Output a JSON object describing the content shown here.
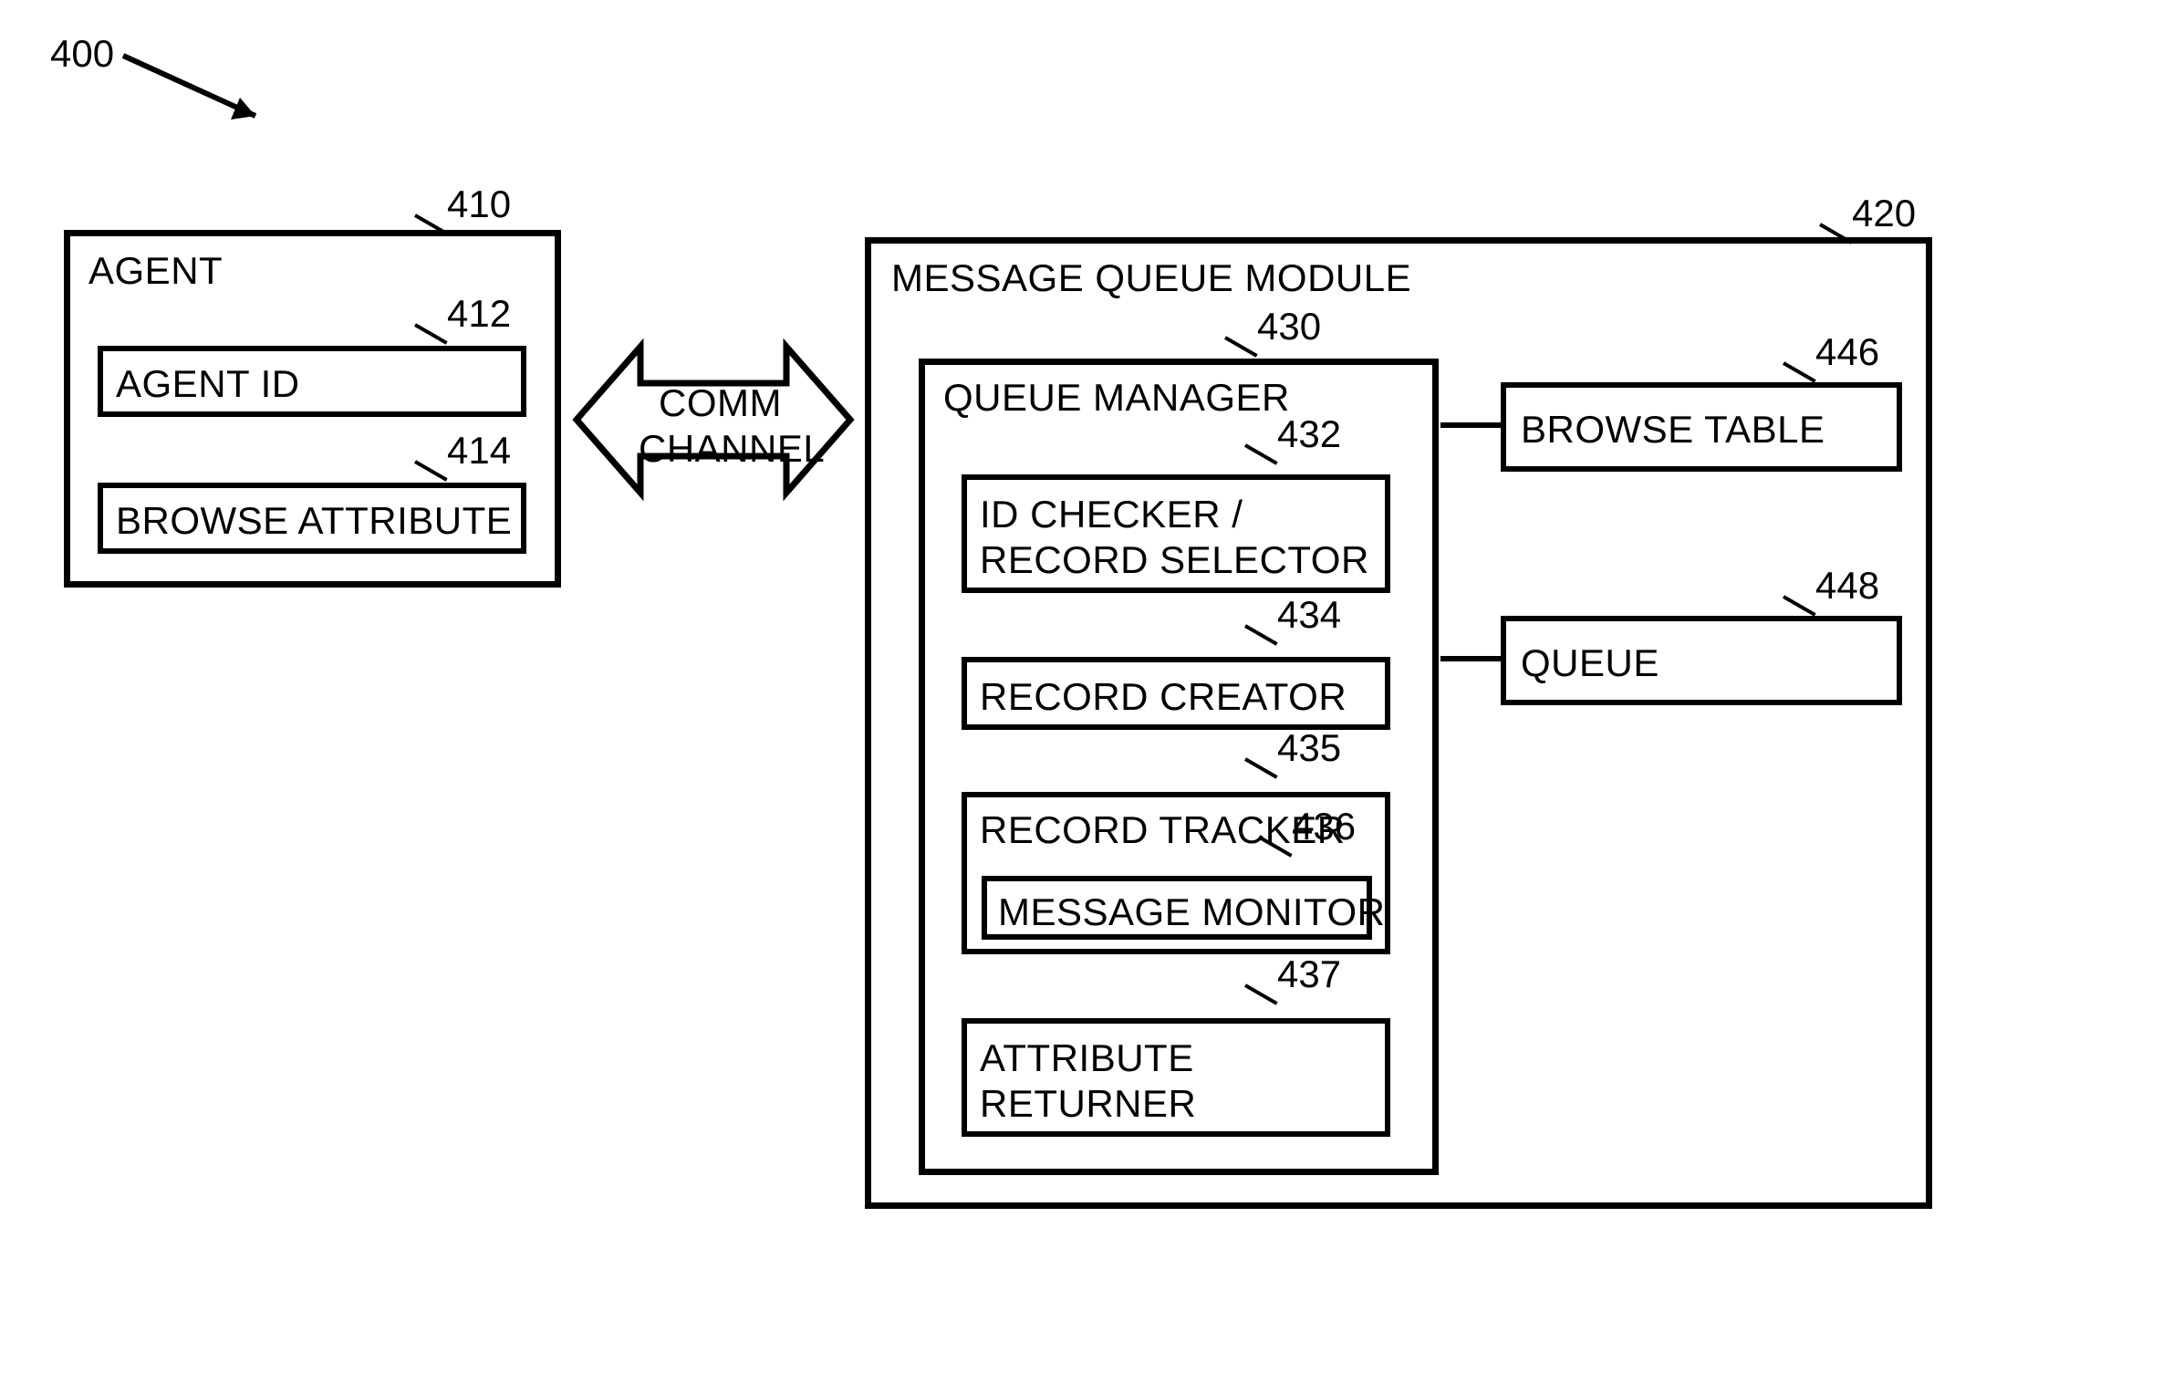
{
  "figure_ref": "400",
  "agent": {
    "ref": "410",
    "title": "AGENT",
    "agent_id": {
      "ref": "412",
      "label": "AGENT ID"
    },
    "browse_attribute": {
      "ref": "414",
      "label": "BROWSE ATTRIBUTE"
    }
  },
  "comm_channel": {
    "line1": "COMM",
    "line2": "CHANNEL"
  },
  "mq_module": {
    "ref": "420",
    "title": "MESSAGE QUEUE MODULE",
    "queue_manager": {
      "ref": "430",
      "title": "QUEUE MANAGER",
      "id_checker": {
        "ref": "432",
        "line1": "ID CHECKER /",
        "line2": "RECORD SELECTOR"
      },
      "record_creator": {
        "ref": "434",
        "label": "RECORD CREATOR"
      },
      "record_tracker": {
        "ref": "435",
        "label": "RECORD TRACKER",
        "message_monitor": {
          "ref": "436",
          "label": "MESSAGE MONITOR"
        }
      },
      "attribute_returner": {
        "ref": "437",
        "line1": "ATTRIBUTE",
        "line2": "RETURNER"
      }
    },
    "browse_table": {
      "ref": "446",
      "label": "BROWSE TABLE"
    },
    "queue": {
      "ref": "448",
      "label": "QUEUE"
    }
  }
}
